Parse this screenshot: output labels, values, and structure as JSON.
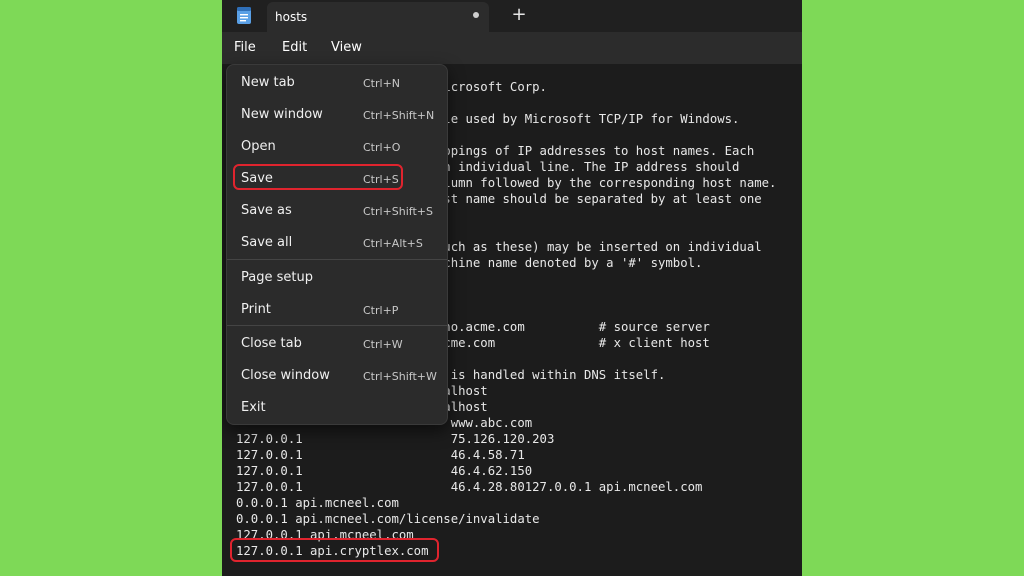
{
  "tab": {
    "title": "hosts"
  },
  "new_tab_symbol": "+",
  "menubar": {
    "file": "File",
    "edit": "Edit",
    "view": "View"
  },
  "file_menu": [
    {
      "label": "New tab",
      "shortcut": "Ctrl+N"
    },
    {
      "label": "New window",
      "shortcut": "Ctrl+Shift+N"
    },
    {
      "label": "Open",
      "shortcut": "Ctrl+O"
    },
    {
      "label": "Save",
      "shortcut": "Ctrl+S"
    },
    {
      "label": "Save as",
      "shortcut": "Ctrl+Shift+S"
    },
    {
      "label": "Save all",
      "shortcut": "Ctrl+Alt+S"
    },
    {
      "label": "Page setup",
      "shortcut": ""
    },
    {
      "label": "Print",
      "shortcut": "Ctrl+P"
    },
    {
      "label": "Close tab",
      "shortcut": "Ctrl+W"
    },
    {
      "label": "Close window",
      "shortcut": "Ctrl+Shift+W"
    },
    {
      "label": "Exit",
      "shortcut": ""
    }
  ],
  "editor_lines": [
    "                            icrosoft Corp.",
    "",
    "                            le used by Microsoft TCP/IP for Windows.",
    "",
    "                            ppings of IP addresses to host names. Each",
    "                            n individual line. The IP address should",
    "                            lumn followed by the corresponding host name.",
    "                            st name should be separated by at least one",
    "",
    "",
    "                            uch as these) may be inserted on individual",
    "                            chine name denoted by a '#' symbol.",
    "",
    "",
    "",
    "                            no.acme.com          # source server",
    "                            cme.com              # x client host",
    "",
    "                             is handled within DNS itself.",
    "                            alhost",
    "                            alhost",
    "                             www.abc.com",
    "127.0.0.1                    75.126.120.203",
    "127.0.0.1                    46.4.58.71",
    "127.0.0.1                    46.4.62.150",
    "127.0.0.1                    46.4.28.80127.0.0.1 api.mcneel.com",
    "0.0.0.1 api.mcneel.com",
    "0.0.0.1 api.mcneel.com/license/invalidate",
    "127.0.0.1 api.mcneel.com",
    "127.0.0.1 api.cryptlex.com"
  ],
  "colors": {
    "background": "#7ed957",
    "editor_bg": "#1c1c1c",
    "menu_bg": "#2b2b2b",
    "highlight": "#e0242e"
  },
  "icons": [
    "notepad-icon",
    "tab-modified-dot-icon"
  ]
}
